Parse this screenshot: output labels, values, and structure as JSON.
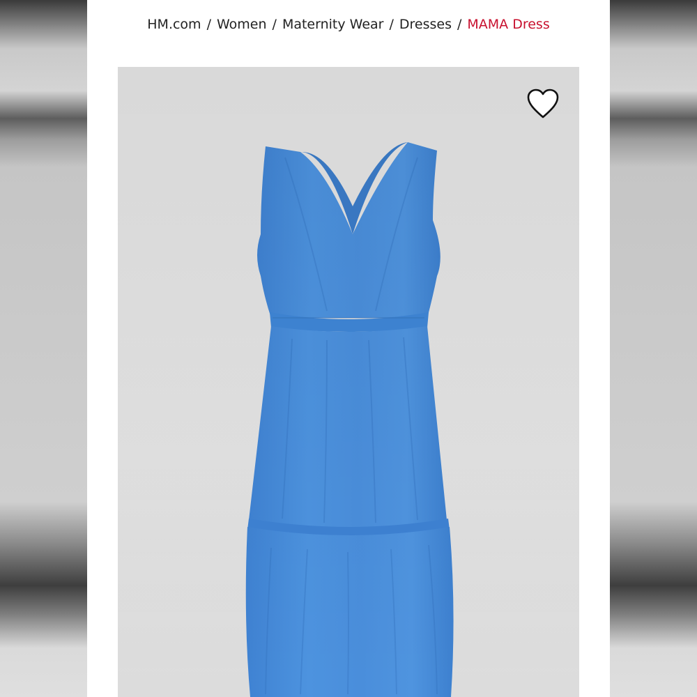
{
  "breadcrumb": {
    "items": [
      "HM.com",
      "Women",
      "Maternity Wear",
      "Dresses"
    ],
    "separator": "/",
    "current": "MAMA Dress"
  },
  "product": {
    "image_icon": "dress-image",
    "favorite_icon": "heart-outline-icon"
  },
  "colors": {
    "accent": "#c8102e",
    "dress": "#4a8fdc",
    "image_background": "#e3e3e3"
  }
}
